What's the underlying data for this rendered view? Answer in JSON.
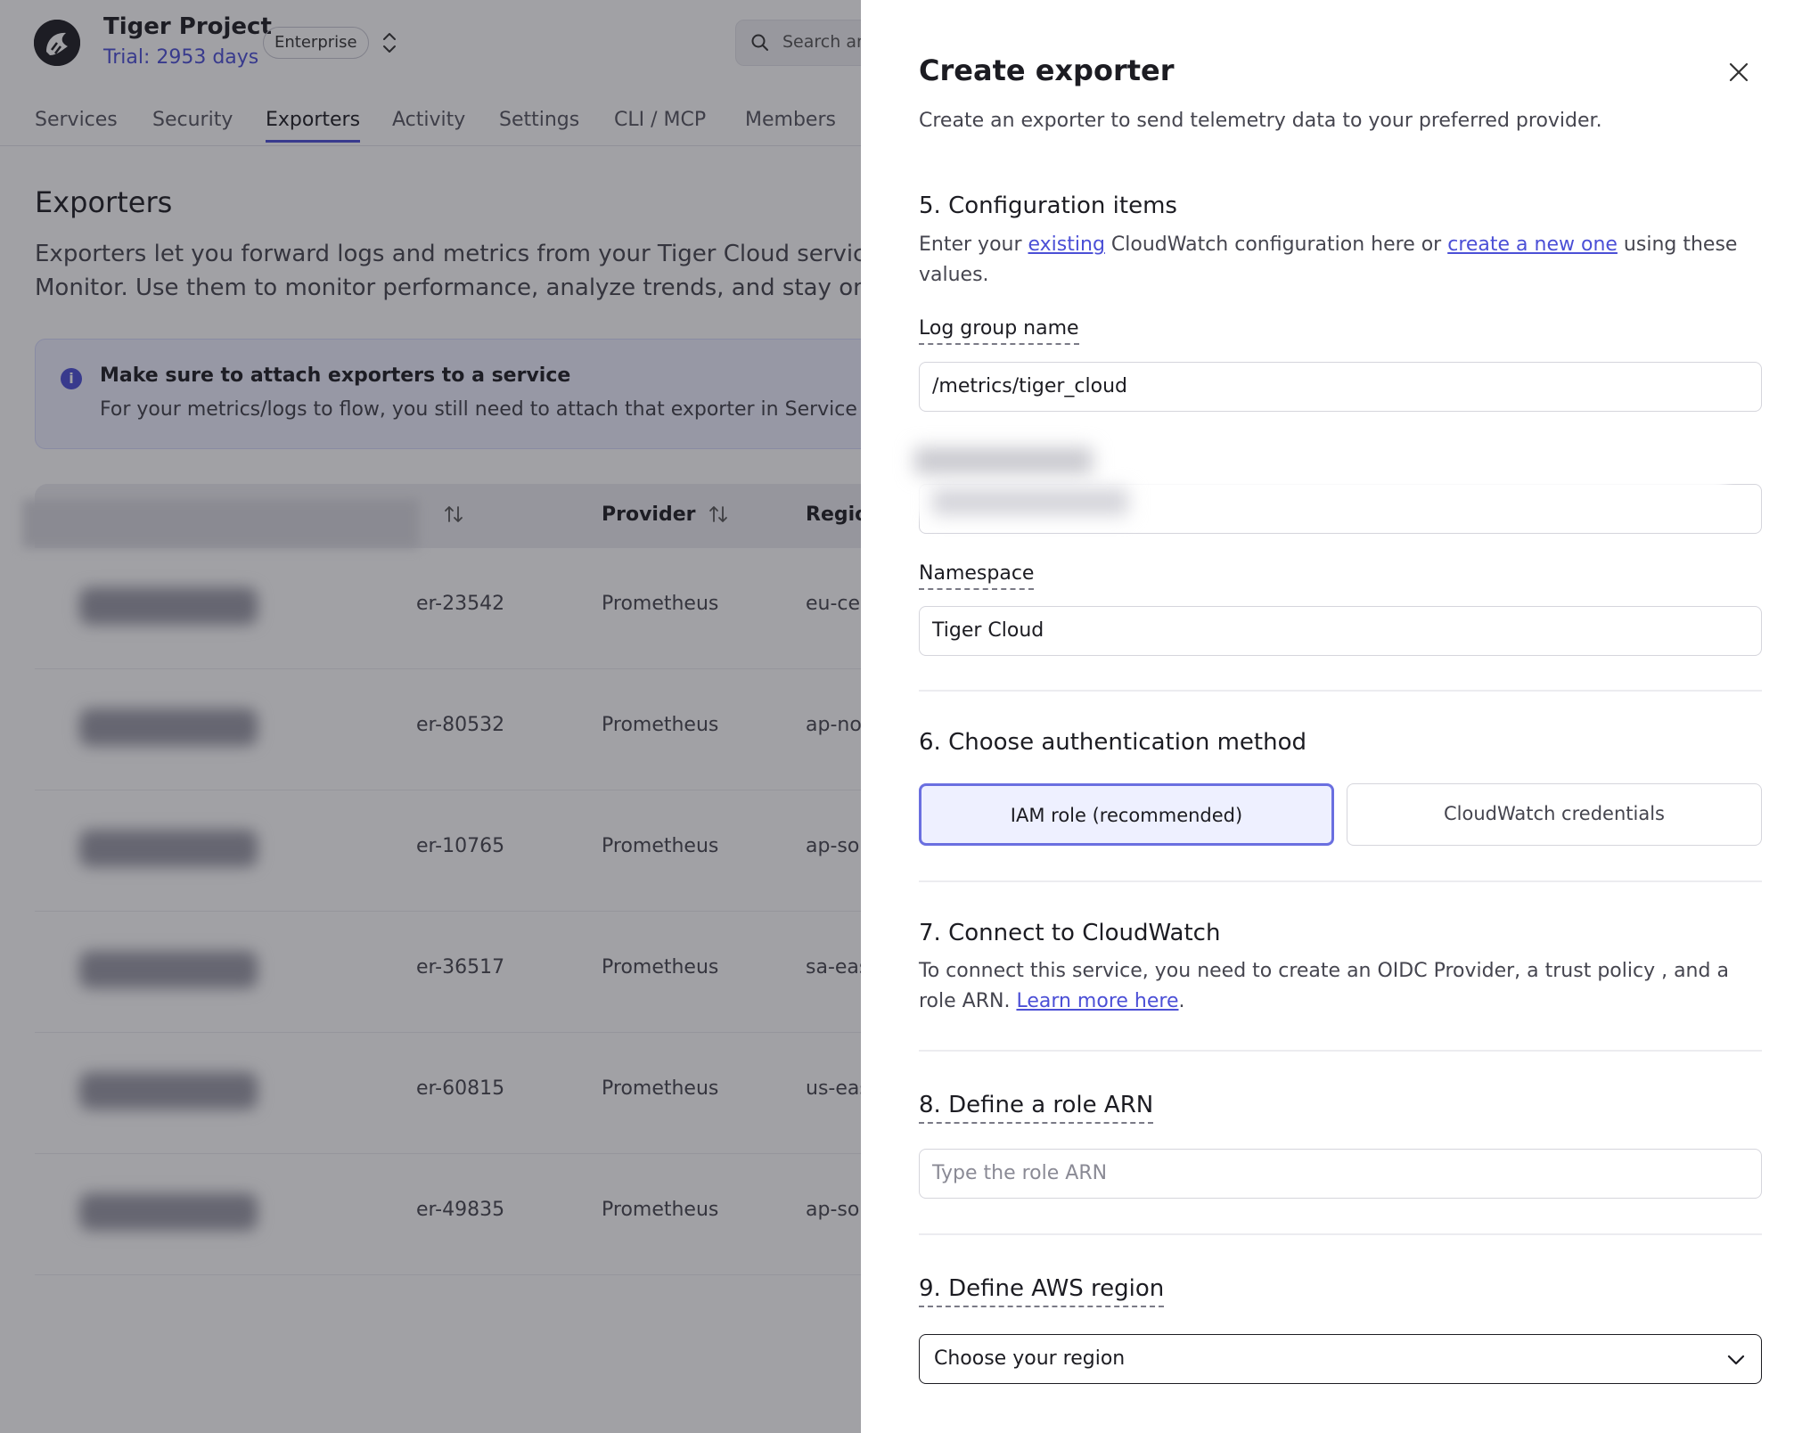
{
  "header": {
    "project_name": "Tiger Project",
    "trial": "Trial: 2953 days",
    "plan_badge": "Enterprise",
    "search_placeholder": "Search an"
  },
  "tabs": [
    {
      "label": "Services"
    },
    {
      "label": "Security"
    },
    {
      "label": "Exporters",
      "active": true
    },
    {
      "label": "Activity"
    },
    {
      "label": "Settings"
    },
    {
      "label": "CLI / MCP"
    },
    {
      "label": "Members"
    }
  ],
  "page": {
    "title": "Exporters",
    "desc_line1": "Exporters let you forward logs and metrics from your Tiger Cloud services to",
    "desc_line2": "Monitor. Use them to monitor performance, analyze trends, and stay on top o"
  },
  "info": {
    "title": "Make sure to attach exporters to a service",
    "text": "For your metrics/logs to flow, you still need to attach that exporter in Service > Oper"
  },
  "table": {
    "headers": {
      "provider": "Provider",
      "region": "Regio"
    },
    "rows": [
      {
        "name": "er-23542",
        "provider": "Prometheus",
        "region": "eu-cer"
      },
      {
        "name": "er-80532",
        "provider": "Prometheus",
        "region": "ap-no"
      },
      {
        "name": "er-10765",
        "provider": "Prometheus",
        "region": "ap-so"
      },
      {
        "name": "er-36517",
        "provider": "Prometheus",
        "region": "sa-eas"
      },
      {
        "name": "er-60815",
        "provider": "Prometheus",
        "region": "us-eas"
      },
      {
        "name": "er-49835",
        "provider": "Prometheus",
        "region": "ap-so"
      }
    ]
  },
  "drawer": {
    "title": "Create exporter",
    "subtitle": "Create an exporter to send telemetry data to your preferred provider.",
    "sec5": {
      "title": "5. Configuration items",
      "text_prefix": "Enter your ",
      "link_existing": "existing",
      "text_mid": " CloudWatch configuration here or ",
      "link_create": "create a new one",
      "text_suffix": " using these values.",
      "log_group_label": "Log group name",
      "log_group_value": "/metrics/tiger_cloud",
      "namespace_label": "Namespace",
      "namespace_value": "Tiger Cloud"
    },
    "sec6": {
      "title": "6. Choose authentication method",
      "option_iam": "IAM role (recommended)",
      "option_creds": "CloudWatch credentials"
    },
    "sec7": {
      "title": "7. Connect to CloudWatch",
      "text": "To connect this service, you need to create an OIDC Provider, a trust policy , and a role ARN. ",
      "link": "Learn more here",
      "text_end": "."
    },
    "sec8": {
      "title": "8. Define a role ARN",
      "placeholder": "Type the role ARN"
    },
    "sec9": {
      "title": "9. Define AWS region",
      "select_value": "Choose your region"
    }
  },
  "colors": {
    "accent": "#4b4fd6",
    "overlay": "rgba(30,30,40,0.42)"
  }
}
